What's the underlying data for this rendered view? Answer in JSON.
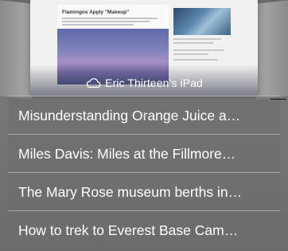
{
  "device": {
    "name": "Eric Thirteen’s iPad",
    "icon": "cloud-icon"
  },
  "thumbnail": {
    "headline": "Flamingos Apply \"Makeup\""
  },
  "tabs": [
    {
      "title": "Misunderstanding Orange Juice a…"
    },
    {
      "title": "Miles Davis: Miles at the Fillmore…"
    },
    {
      "title": "The Mary Rose museum berths in…"
    },
    {
      "title": "How to trek to Everest Base Cam…"
    }
  ],
  "colors": {
    "background": "#6f6f6f",
    "text": "#ffffff",
    "divider": "#dcdcdc"
  }
}
